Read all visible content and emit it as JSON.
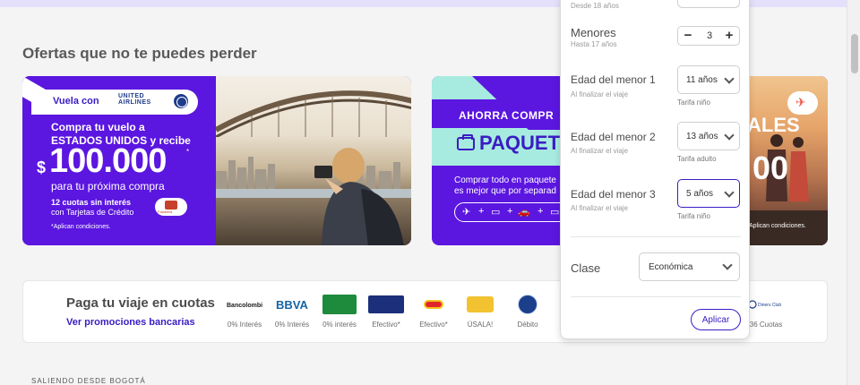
{
  "section": {
    "title": "Ofertas que no te puedes perder"
  },
  "banner1": {
    "vuela": "Vuela con",
    "airline_line1": "UNITED",
    "airline_line2": "AIRLINES",
    "line1": "Compra tu vuelo a",
    "line2": "ESTADOS UNIDOS y recibe",
    "currency": "$",
    "amount": "100.000",
    "star": "*",
    "para": "para tu próxima compra",
    "cuotas_bold": "12 cuotas sin interés",
    "cuotas_sub": "con Tarjetas de Crédito",
    "badge_text": "Falabella",
    "conditions": "*Aplican condiciones."
  },
  "banner2": {
    "ahorra": "AHORRA COMPR",
    "paquete": "PAQUET",
    "text1": "Comprar todo en paquete",
    "text2": "es mejor que por separad",
    "icons": [
      "✈",
      "+",
      "▭",
      "+",
      "🚗",
      "+",
      "▭"
    ],
    "ales": "ALES",
    "big": "00",
    "conditions": "Aplican condiciones."
  },
  "payments": {
    "title": "Paga tu viaje en cuotas",
    "link": "Ver promociones bancarias",
    "banks": [
      {
        "name": "Bancolombia",
        "label": "0% Interés",
        "color": "#1b1b1b"
      },
      {
        "name": "BBVA",
        "label": "0% Interés",
        "color": "#1464a5"
      },
      {
        "name": "Banco popular",
        "label": "0% interés",
        "color": "#1e8a3c"
      },
      {
        "name": "SU RED",
        "label": "Efectivo*",
        "color": "#1b2f7a"
      },
      {
        "name": "Efecty",
        "label": "Efectivo*",
        "color": "#e0262b"
      },
      {
        "name": "USALA",
        "label": "ÚSALA!",
        "color": "#f2c230"
      },
      {
        "name": "PSE",
        "label": "Débito",
        "color": "#1c3f8c"
      }
    ],
    "last_bank": {
      "name": "Diners Club",
      "label": "36 Cuotas"
    }
  },
  "footer": {
    "saliendo": "SALIENDO DESDE BOGOTÁ"
  },
  "panel": {
    "desde": "Desde 18 años",
    "menores": {
      "label": "Menores",
      "sub": "Hasta 17 años",
      "value": "3",
      "minus": "−",
      "plus": "+"
    },
    "children": [
      {
        "label": "Edad del menor 1",
        "sub": "Al finalizar el viaje",
        "value": "11 años",
        "tarifa": "Tarifa niño"
      },
      {
        "label": "Edad del menor 2",
        "sub": "Al finalizar el viaje",
        "value": "13 años",
        "tarifa": "Tarifa adulto"
      },
      {
        "label": "Edad del menor 3",
        "sub": "Al finalizar el viaje",
        "value": "5 años",
        "tarifa": "Tarifa niño"
      }
    ],
    "clase": {
      "label": "Clase",
      "value": "Económica"
    },
    "apply": "Aplicar"
  }
}
